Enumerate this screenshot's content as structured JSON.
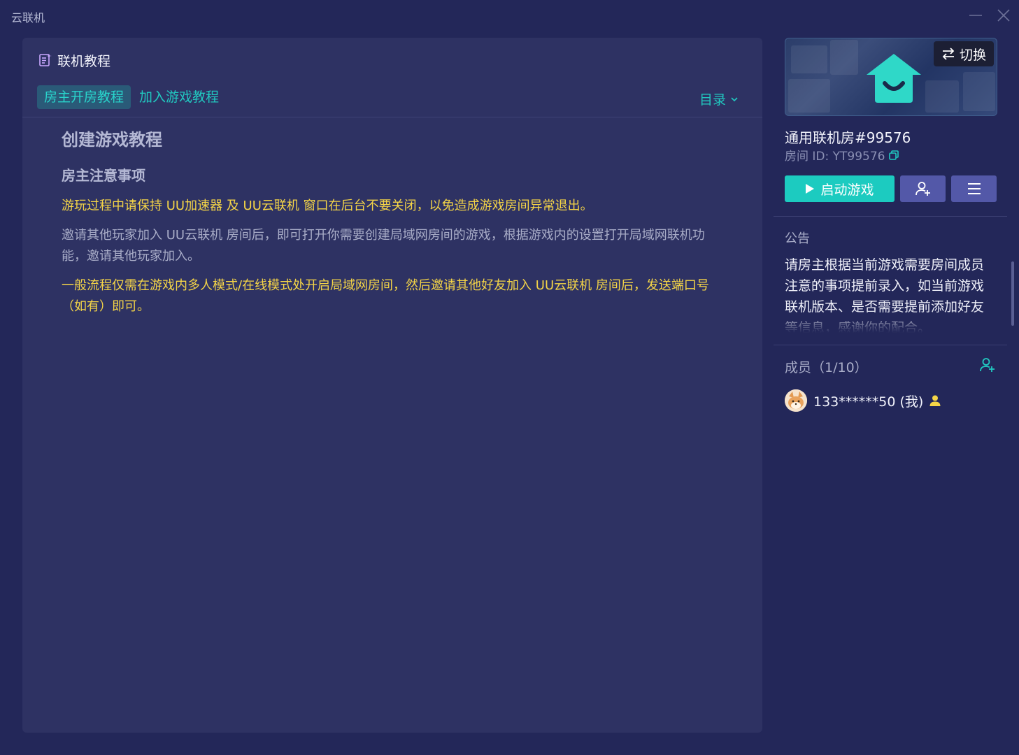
{
  "window": {
    "title": "云联机"
  },
  "tutorial": {
    "header": "联机教程",
    "tabs": [
      {
        "label": "房主开房教程",
        "active": true
      },
      {
        "label": "加入游戏教程",
        "active": false
      }
    ],
    "toc_label": "目录",
    "heading": "创建游戏教程",
    "subheading": "房主注意事项",
    "paragraphs": [
      {
        "text": "游玩过程中请保持 UU加速器 及 UU云联机 窗口在后台不要关闭，以免造成游戏房间异常退出。",
        "color": "yellow"
      },
      {
        "text": "邀请其他玩家加入 UU云联机 房间后，即可打开你需要创建局域网房间的游戏，根据游戏内的设置打开局域网联机功能，邀请其他玩家加入。",
        "color": "gray"
      },
      {
        "text": "一般流程仅需在游戏内多人模式/在线模式处开启局域网房间，然后邀请其他好友加入 UU云联机 房间后，发送端口号（如有）即可。",
        "color": "yellow"
      }
    ]
  },
  "room": {
    "switch_label": "切换",
    "name": "通用联机房#99576",
    "id_label": "房间 ID: YT99576",
    "start_label": "启动游戏"
  },
  "notice": {
    "title": "公告",
    "body": "请房主根据当前游戏需要房间成员注意的事项提前录入，如当前游戏联机版本、是否需要提前添加好友等信息，感谢你的配合。"
  },
  "members": {
    "title": "成员（1/10）",
    "list": [
      {
        "name": "133******50 (我)",
        "is_host": true
      }
    ]
  },
  "colors": {
    "accent": "#1ccbc0",
    "warning_text": "#f5d547",
    "background": "#232759",
    "panel": "#2e3263"
  }
}
